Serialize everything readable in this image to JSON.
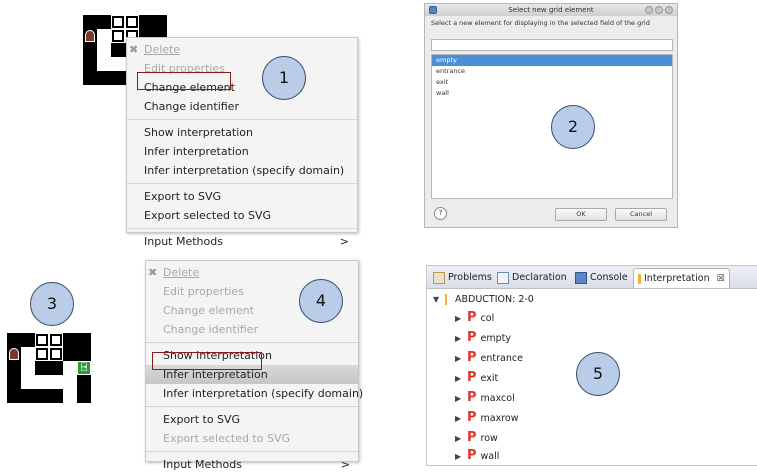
{
  "callouts": [
    "1",
    "2",
    "3",
    "4",
    "5"
  ],
  "menu1": {
    "items": [
      {
        "label": "Delete",
        "disabled": true,
        "icon": "delete-x-icon"
      },
      {
        "label": "Edit properties",
        "disabled": true
      },
      {
        "label": "Change element",
        "disabled": false,
        "highlighted": true
      },
      {
        "label": "Change identifier",
        "disabled": false
      },
      {
        "label": "Show interpretation",
        "disabled": false
      },
      {
        "label": "Infer interpretation",
        "disabled": false
      },
      {
        "label": "Infer interpretation (specify domain)",
        "disabled": false
      },
      {
        "label": "Export to SVG",
        "disabled": false
      },
      {
        "label": "Export selected to SVG",
        "disabled": false
      },
      {
        "label": "Input Methods",
        "disabled": false,
        "submenu_arrow": ">"
      }
    ]
  },
  "menu4": {
    "items": [
      {
        "label": "Delete",
        "disabled": true,
        "icon": "delete-x-icon"
      },
      {
        "label": "Edit properties",
        "disabled": true
      },
      {
        "label": "Change element",
        "disabled": true
      },
      {
        "label": "Change identifier",
        "disabled": true
      },
      {
        "label": "Show interpretation",
        "disabled": false
      },
      {
        "label": "Infer interpretation",
        "disabled": false,
        "highlighted": true
      },
      {
        "label": "Infer interpretation (specify domain)",
        "disabled": false
      },
      {
        "label": "Export to SVG",
        "disabled": false
      },
      {
        "label": "Export selected to SVG",
        "disabled": true
      },
      {
        "label": "Input Methods",
        "disabled": false,
        "submenu_arrow": ">"
      }
    ]
  },
  "dialog": {
    "title": "Select new grid element",
    "instruction": "Select a new element for displaying in the selected field of the grid",
    "filter_value": "",
    "options": [
      "empty",
      "entrance",
      "exit",
      "wall"
    ],
    "selected": "empty",
    "help": "?",
    "ok_label": "OK",
    "cancel_label": "Cancel"
  },
  "panel": {
    "tabs": [
      {
        "label": "Problems",
        "icon": "problems-icon"
      },
      {
        "label": "Declaration",
        "icon": "declaration-icon"
      },
      {
        "label": "Console",
        "icon": "console-icon"
      },
      {
        "label": "Interpretation",
        "icon": "interpretation-icon",
        "active": true,
        "close": "☒"
      }
    ],
    "root": "ABDUCTION: 2-0",
    "predicate_letter": "P",
    "predicates": [
      "col",
      "empty",
      "entrance",
      "exit",
      "maxcol",
      "maxrow",
      "row",
      "wall"
    ]
  },
  "exit_glyph": "⍈",
  "colors": {
    "highlight": "#8b1a1a",
    "callout": "#b9cde8",
    "predicate": "#e0342e",
    "selected_item": "#4a90d9",
    "exit": "#2e9a3a",
    "entrance": "#7a3a2a"
  }
}
